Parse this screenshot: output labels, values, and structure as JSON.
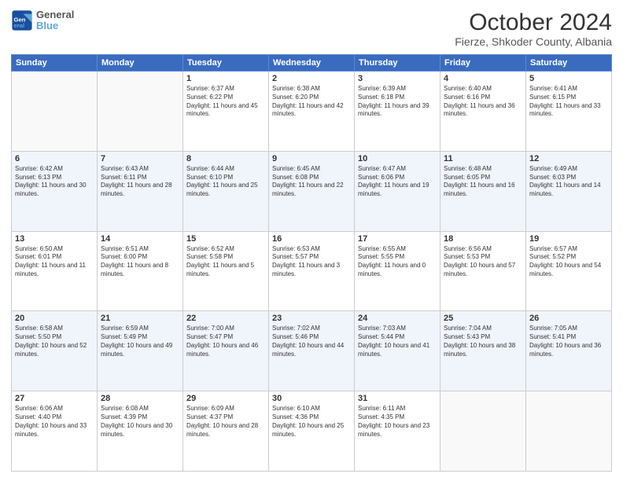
{
  "header": {
    "logo_line1": "General",
    "logo_line2": "Blue",
    "title": "October 2024",
    "subtitle": "Fierze, Shkoder County, Albania"
  },
  "calendar": {
    "days_of_week": [
      "Sunday",
      "Monday",
      "Tuesday",
      "Wednesday",
      "Thursday",
      "Friday",
      "Saturday"
    ],
    "weeks": [
      [
        {
          "day": null,
          "info": null
        },
        {
          "day": null,
          "info": null
        },
        {
          "day": "1",
          "info": "Sunrise: 6:37 AM\nSunset: 6:22 PM\nDaylight: 11 hours and 45 minutes."
        },
        {
          "day": "2",
          "info": "Sunrise: 6:38 AM\nSunset: 6:20 PM\nDaylight: 11 hours and 42 minutes."
        },
        {
          "day": "3",
          "info": "Sunrise: 6:39 AM\nSunset: 6:18 PM\nDaylight: 11 hours and 39 minutes."
        },
        {
          "day": "4",
          "info": "Sunrise: 6:40 AM\nSunset: 6:16 PM\nDaylight: 11 hours and 36 minutes."
        },
        {
          "day": "5",
          "info": "Sunrise: 6:41 AM\nSunset: 6:15 PM\nDaylight: 11 hours and 33 minutes."
        }
      ],
      [
        {
          "day": "6",
          "info": "Sunrise: 6:42 AM\nSunset: 6:13 PM\nDaylight: 11 hours and 30 minutes."
        },
        {
          "day": "7",
          "info": "Sunrise: 6:43 AM\nSunset: 6:11 PM\nDaylight: 11 hours and 28 minutes."
        },
        {
          "day": "8",
          "info": "Sunrise: 6:44 AM\nSunset: 6:10 PM\nDaylight: 11 hours and 25 minutes."
        },
        {
          "day": "9",
          "info": "Sunrise: 6:45 AM\nSunset: 6:08 PM\nDaylight: 11 hours and 22 minutes."
        },
        {
          "day": "10",
          "info": "Sunrise: 6:47 AM\nSunset: 6:06 PM\nDaylight: 11 hours and 19 minutes."
        },
        {
          "day": "11",
          "info": "Sunrise: 6:48 AM\nSunset: 6:05 PM\nDaylight: 11 hours and 16 minutes."
        },
        {
          "day": "12",
          "info": "Sunrise: 6:49 AM\nSunset: 6:03 PM\nDaylight: 11 hours and 14 minutes."
        }
      ],
      [
        {
          "day": "13",
          "info": "Sunrise: 6:50 AM\nSunset: 6:01 PM\nDaylight: 11 hours and 11 minutes."
        },
        {
          "day": "14",
          "info": "Sunrise: 6:51 AM\nSunset: 6:00 PM\nDaylight: 11 hours and 8 minutes."
        },
        {
          "day": "15",
          "info": "Sunrise: 6:52 AM\nSunset: 5:58 PM\nDaylight: 11 hours and 5 minutes."
        },
        {
          "day": "16",
          "info": "Sunrise: 6:53 AM\nSunset: 5:57 PM\nDaylight: 11 hours and 3 minutes."
        },
        {
          "day": "17",
          "info": "Sunrise: 6:55 AM\nSunset: 5:55 PM\nDaylight: 11 hours and 0 minutes."
        },
        {
          "day": "18",
          "info": "Sunrise: 6:56 AM\nSunset: 5:53 PM\nDaylight: 10 hours and 57 minutes."
        },
        {
          "day": "19",
          "info": "Sunrise: 6:57 AM\nSunset: 5:52 PM\nDaylight: 10 hours and 54 minutes."
        }
      ],
      [
        {
          "day": "20",
          "info": "Sunrise: 6:58 AM\nSunset: 5:50 PM\nDaylight: 10 hours and 52 minutes."
        },
        {
          "day": "21",
          "info": "Sunrise: 6:59 AM\nSunset: 5:49 PM\nDaylight: 10 hours and 49 minutes."
        },
        {
          "day": "22",
          "info": "Sunrise: 7:00 AM\nSunset: 5:47 PM\nDaylight: 10 hours and 46 minutes."
        },
        {
          "day": "23",
          "info": "Sunrise: 7:02 AM\nSunset: 5:46 PM\nDaylight: 10 hours and 44 minutes."
        },
        {
          "day": "24",
          "info": "Sunrise: 7:03 AM\nSunset: 5:44 PM\nDaylight: 10 hours and 41 minutes."
        },
        {
          "day": "25",
          "info": "Sunrise: 7:04 AM\nSunset: 5:43 PM\nDaylight: 10 hours and 38 minutes."
        },
        {
          "day": "26",
          "info": "Sunrise: 7:05 AM\nSunset: 5:41 PM\nDaylight: 10 hours and 36 minutes."
        }
      ],
      [
        {
          "day": "27",
          "info": "Sunrise: 6:06 AM\nSunset: 4:40 PM\nDaylight: 10 hours and 33 minutes."
        },
        {
          "day": "28",
          "info": "Sunrise: 6:08 AM\nSunset: 4:39 PM\nDaylight: 10 hours and 30 minutes."
        },
        {
          "day": "29",
          "info": "Sunrise: 6:09 AM\nSunset: 4:37 PM\nDaylight: 10 hours and 28 minutes."
        },
        {
          "day": "30",
          "info": "Sunrise: 6:10 AM\nSunset: 4:36 PM\nDaylight: 10 hours and 25 minutes."
        },
        {
          "day": "31",
          "info": "Sunrise: 6:11 AM\nSunset: 4:35 PM\nDaylight: 10 hours and 23 minutes."
        },
        {
          "day": null,
          "info": null
        },
        {
          "day": null,
          "info": null
        }
      ]
    ]
  }
}
